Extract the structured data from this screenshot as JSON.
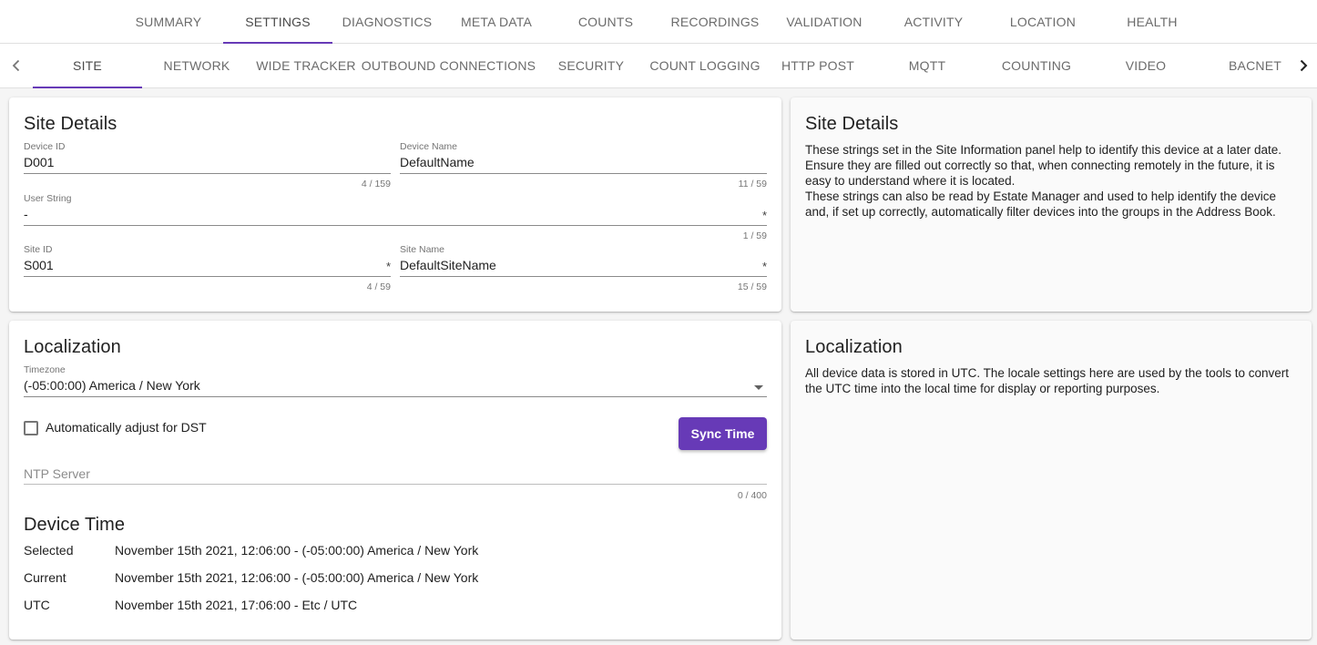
{
  "top_tabs": [
    "SUMMARY",
    "SETTINGS",
    "DIAGNOSTICS",
    "META DATA",
    "COUNTS",
    "RECORDINGS",
    "VALIDATION",
    "ACTIVITY",
    "LOCATION",
    "HEALTH"
  ],
  "sub_tabs": [
    "SITE",
    "NETWORK",
    "WIDE TRACKER",
    "OUTBOUND CONNECTIONS",
    "SECURITY",
    "COUNT LOGGING",
    "HTTP POST",
    "MQTT",
    "COUNTING",
    "VIDEO",
    "BACNET"
  ],
  "icons": {
    "prev": "chevron-left-icon",
    "next": "chevron-right-icon",
    "dropdown": "arrow-drop-down-icon"
  },
  "colors": {
    "accent": "#673ab7"
  },
  "site_details": {
    "title": "Site Details",
    "device_id": {
      "label": "Device ID",
      "value": "D001",
      "counter": "4 / 159"
    },
    "device_name": {
      "label": "Device Name",
      "value": "DefaultName",
      "counter": "11 / 59"
    },
    "user_string": {
      "label": "User String",
      "value": "-",
      "required": "*",
      "counter": "1 / 59"
    },
    "site_id": {
      "label": "Site ID",
      "value": "S001",
      "required": "*",
      "counter": "4 / 59"
    },
    "site_name": {
      "label": "Site Name",
      "value": "DefaultSiteName",
      "required": "*",
      "counter": "15 / 59"
    }
  },
  "site_info": {
    "title": "Site Details",
    "para1": "These strings set in the Site Information panel help to identify this device at a later date. Ensure they are filled out correctly so that, when connecting remotely in the future, it is easy to understand where it is located.",
    "para2": "These strings can also be read by Estate Manager and used to help identify the device and, if set up correctly, automatically filter devices into the groups in the Address Book."
  },
  "localization": {
    "title": "Localization",
    "timezone_label": "Timezone",
    "timezone_value": "(-05:00:00) America / New York",
    "dst_label": "Automatically adjust for DST",
    "dst_checked": false,
    "sync_button": "Sync Time",
    "ntp_placeholder": "NTP Server",
    "ntp_counter": "0 / 400",
    "device_time_title": "Device Time",
    "rows": [
      {
        "key": "Selected",
        "value": "November 15th 2021, 12:06:00 - (-05:00:00) America / New York"
      },
      {
        "key": "Current",
        "value": "November 15th 2021, 12:06:00 - (-05:00:00) America / New York"
      },
      {
        "key": "UTC",
        "value": "November 15th 2021, 17:06:00 - Etc / UTC"
      }
    ]
  },
  "localization_info": {
    "title": "Localization",
    "text": "All device data is stored in UTC. The locale settings here are used by the tools to convert the UTC time into the local time for display or reporting purposes."
  }
}
